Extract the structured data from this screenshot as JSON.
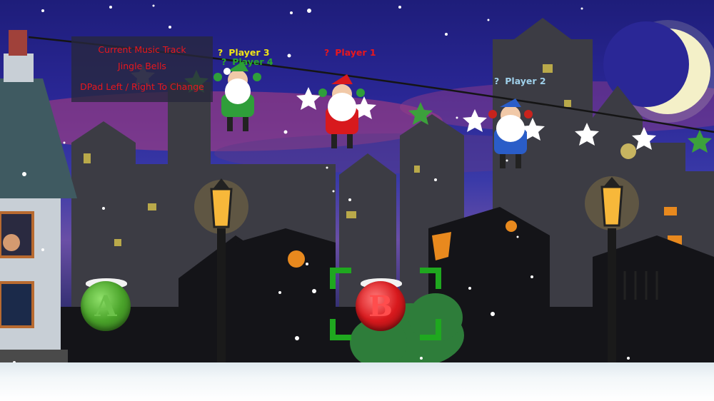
{
  "music_panel": {
    "heading": "Current Music Track",
    "track": "Jingle Bells",
    "hint": "DPad Left / Right To Change"
  },
  "players": [
    {
      "name": "Player 3",
      "prefix": "?",
      "color": "#f0e416"
    },
    {
      "name": "Player 4",
      "prefix": "?",
      "color": "#27a82c"
    },
    {
      "name": "Player 1",
      "prefix": "?",
      "color": "#e8171d"
    },
    {
      "name": "Player 2",
      "prefix": "?",
      "color": "#9fd0ea"
    }
  ],
  "buttons": {
    "a_label": "A",
    "b_label": "B",
    "a_color": "#4aa32a",
    "b_color": "#d8191d",
    "selection_color": "#1fa81f"
  },
  "colors": {
    "sky_top": "#1e1d7a",
    "moon": "#f4f0c8",
    "city": "#3a3a40",
    "lamp_glow": "#ffcc44"
  }
}
